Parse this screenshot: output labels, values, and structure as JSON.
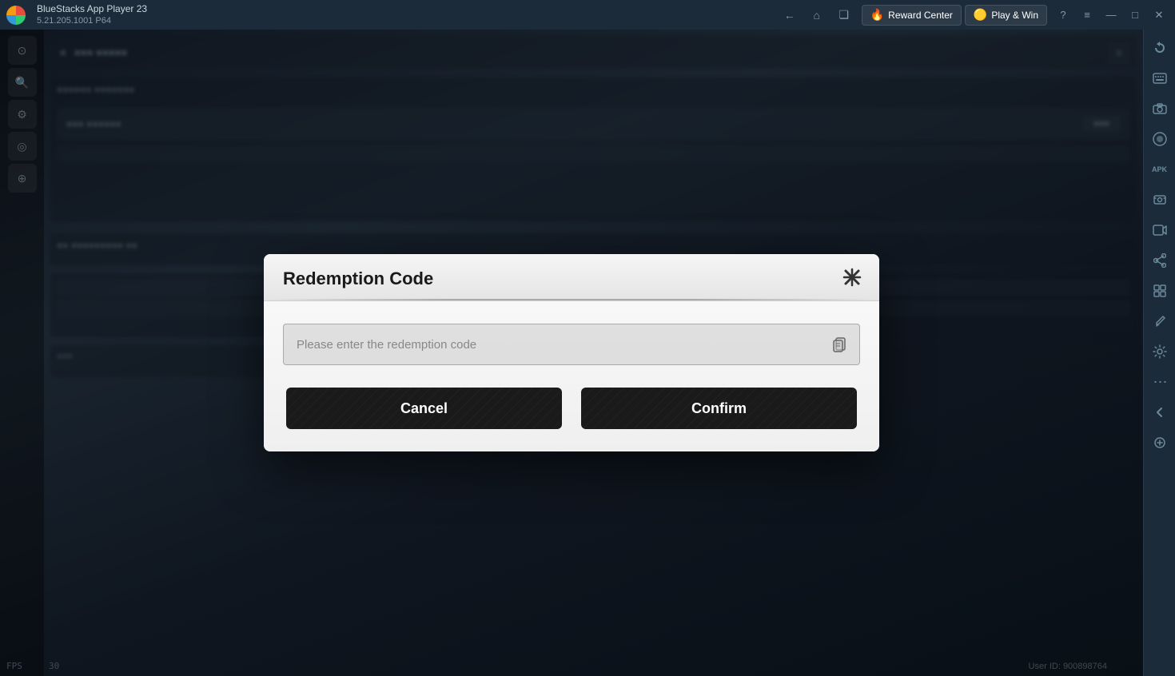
{
  "titlebar": {
    "app_name": "BlueStacks App Player 23",
    "app_version": "5.21.205.1001 P64",
    "nav": {
      "back_label": "←",
      "home_label": "⌂",
      "multi_label": "❏"
    },
    "reward_center_label": "Reward Center",
    "play_win_label": "Play & Win",
    "help_label": "?",
    "menu_label": "≡",
    "minimize_label": "—",
    "maximize_label": "□",
    "close_label": "✕"
  },
  "right_sidebar": {
    "icons": [
      {
        "name": "rotate-icon",
        "symbol": "↻",
        "label": "Rotate"
      },
      {
        "name": "keyboard-icon",
        "symbol": "⌨",
        "label": "Keyboard"
      },
      {
        "name": "camera-icon",
        "symbol": "📷",
        "label": "Camera"
      },
      {
        "name": "record-icon",
        "symbol": "⊙",
        "label": "Record"
      },
      {
        "name": "apk-icon",
        "symbol": "APK",
        "label": "APK"
      },
      {
        "name": "photo-icon",
        "symbol": "🖼",
        "label": "Photo"
      },
      {
        "name": "video-icon",
        "symbol": "🎬",
        "label": "Video"
      },
      {
        "name": "share-icon",
        "symbol": "↑",
        "label": "Share"
      },
      {
        "name": "layout-icon",
        "symbol": "⊞",
        "label": "Layout"
      },
      {
        "name": "brush-icon",
        "symbol": "✒",
        "label": "Brush"
      },
      {
        "name": "settings-icon",
        "symbol": "⚙",
        "label": "Settings"
      },
      {
        "name": "more-icon",
        "symbol": "•••",
        "label": "More"
      },
      {
        "name": "collapse-icon",
        "symbol": "←",
        "label": "Collapse"
      },
      {
        "name": "expand-icon",
        "symbol": "⊕",
        "label": "Expand"
      }
    ]
  },
  "fps": {
    "label": "FPS",
    "value": "30"
  },
  "user_id": {
    "label": "User ID: 900898764"
  },
  "dialog": {
    "title": "Redemption Code",
    "close_label": "✕",
    "input_placeholder": "Please enter the redemption code",
    "paste_icon": "⎘",
    "cancel_label": "Cancel",
    "confirm_label": "Confirm"
  }
}
